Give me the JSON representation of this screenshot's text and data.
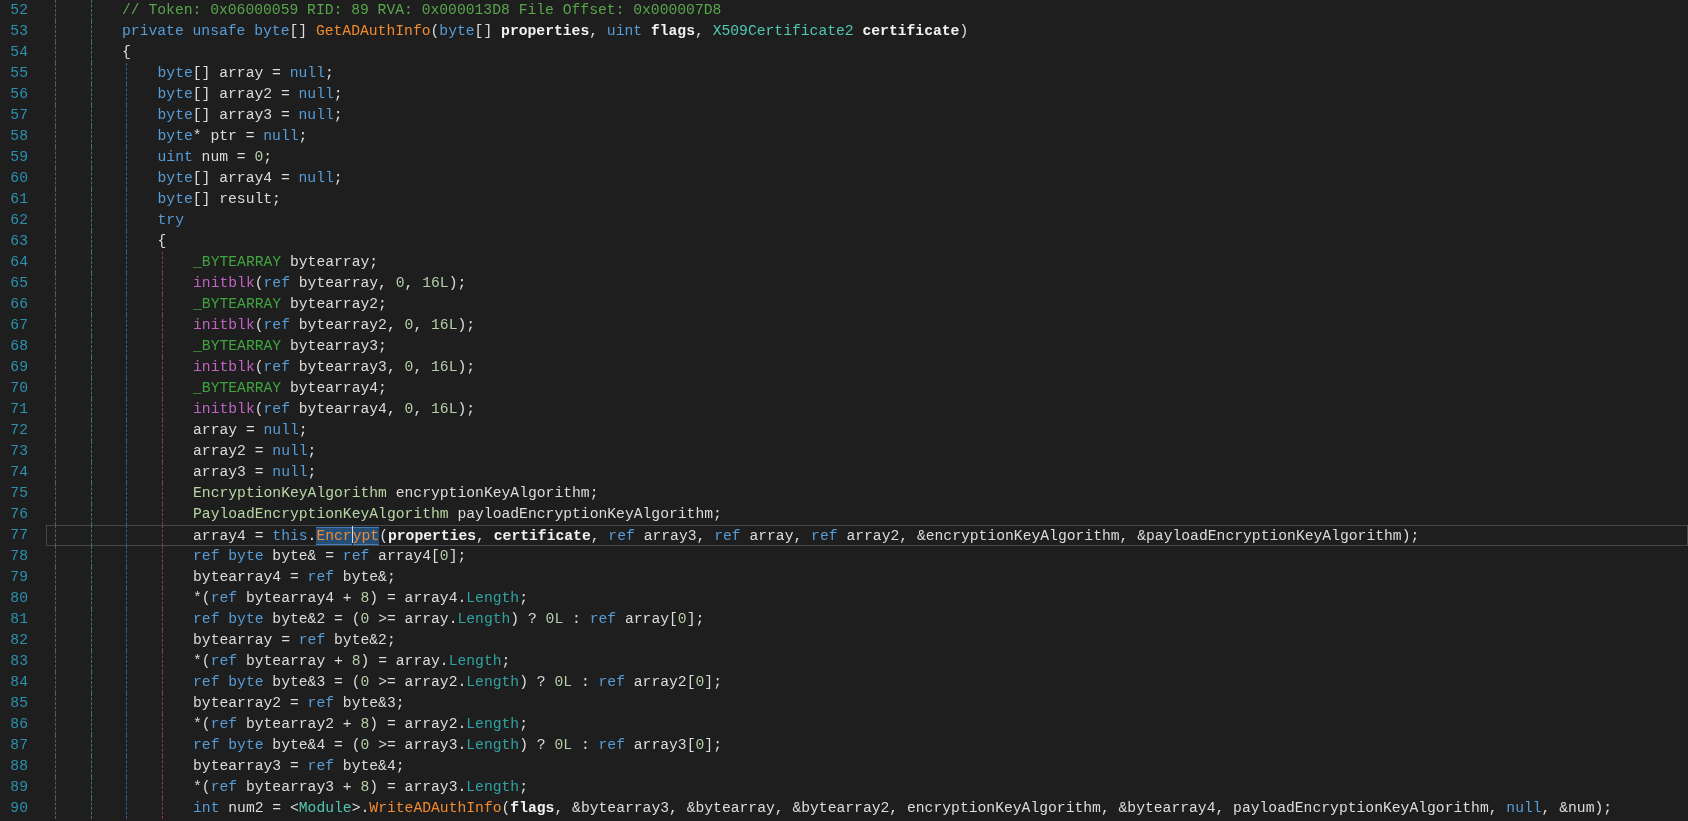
{
  "lines": [
    {
      "n": "52",
      "current": false,
      "tokens": [
        {
          "t": "// Token: 0x06000059 RID: 89 RVA: 0x000013D8 File Offset: 0x000007D8",
          "kind": "comment"
        }
      ]
    },
    {
      "n": "53",
      "current": false,
      "tokens": [
        {
          "t": "private unsafe byte",
          "kind": "keyword"
        },
        {
          "t": "[] ",
          "kind": "plain"
        },
        {
          "t": "GetADAuthInfo",
          "kind": "method"
        },
        {
          "t": "(",
          "kind": "plain"
        },
        {
          "t": "byte",
          "kind": "keyword"
        },
        {
          "t": "[] ",
          "kind": "plain"
        },
        {
          "t": "properties",
          "kind": "param"
        },
        {
          "t": ", ",
          "kind": "plain"
        },
        {
          "t": "uint ",
          "kind": "keyword"
        },
        {
          "t": "flags",
          "kind": "param"
        },
        {
          "t": ", ",
          "kind": "plain"
        },
        {
          "t": "X509Certificate2 ",
          "kind": "type"
        },
        {
          "t": "certificate",
          "kind": "param"
        },
        {
          "t": ")",
          "kind": "plain"
        }
      ]
    },
    {
      "n": "54",
      "current": false,
      "tokens": [
        {
          "t": "{",
          "kind": "plain"
        }
      ],
      "children": [
        {
          "n": "55",
          "current": false,
          "tokens": [
            {
              "t": "byte",
              "kind": "keyword"
            },
            {
              "t": "[] array = ",
              "kind": "plain"
            },
            {
              "t": "null",
              "kind": "keyword"
            },
            {
              "t": ";",
              "kind": "plain"
            }
          ]
        },
        {
          "n": "56",
          "current": false,
          "tokens": [
            {
              "t": "byte",
              "kind": "keyword"
            },
            {
              "t": "[] array2 = ",
              "kind": "plain"
            },
            {
              "t": "null",
              "kind": "keyword"
            },
            {
              "t": ";",
              "kind": "plain"
            }
          ]
        },
        {
          "n": "57",
          "current": false,
          "tokens": [
            {
              "t": "byte",
              "kind": "keyword"
            },
            {
              "t": "[] array3 = ",
              "kind": "plain"
            },
            {
              "t": "null",
              "kind": "keyword"
            },
            {
              "t": ";",
              "kind": "plain"
            }
          ]
        },
        {
          "n": "58",
          "current": false,
          "tokens": [
            {
              "t": "byte",
              "kind": "keyword"
            },
            {
              "t": "* ptr = ",
              "kind": "plain"
            },
            {
              "t": "null",
              "kind": "keyword"
            },
            {
              "t": ";",
              "kind": "plain"
            }
          ]
        },
        {
          "n": "59",
          "current": false,
          "tokens": [
            {
              "t": "uint",
              "kind": "keyword"
            },
            {
              "t": " num = ",
              "kind": "plain"
            },
            {
              "t": "0",
              "kind": "number"
            },
            {
              "t": ";",
              "kind": "plain"
            }
          ]
        },
        {
          "n": "60",
          "current": false,
          "tokens": [
            {
              "t": "byte",
              "kind": "keyword"
            },
            {
              "t": "[] array4 = ",
              "kind": "plain"
            },
            {
              "t": "null",
              "kind": "keyword"
            },
            {
              "t": ";",
              "kind": "plain"
            }
          ]
        },
        {
          "n": "61",
          "current": false,
          "tokens": [
            {
              "t": "byte",
              "kind": "keyword"
            },
            {
              "t": "[] result;",
              "kind": "plain"
            }
          ]
        },
        {
          "n": "62",
          "current": false,
          "tokens": [
            {
              "t": "try",
              "kind": "keyword"
            }
          ]
        },
        {
          "n": "63",
          "current": false,
          "tokens": [
            {
              "t": "{",
              "kind": "plain"
            }
          ],
          "children": [
            {
              "n": "64",
              "current": false,
              "tokens": [
                {
                  "t": "_BYTEARRAY",
                  "kind": "struct"
                },
                {
                  "t": " bytearray;",
                  "kind": "plain"
                }
              ]
            },
            {
              "n": "65",
              "current": false,
              "tokens": [
                {
                  "t": "initblk",
                  "kind": "intrinsic"
                },
                {
                  "t": "(",
                  "kind": "plain"
                },
                {
                  "t": "ref",
                  "kind": "keyword"
                },
                {
                  "t": " bytearray, ",
                  "kind": "plain"
                },
                {
                  "t": "0",
                  "kind": "number"
                },
                {
                  "t": ", ",
                  "kind": "plain"
                },
                {
                  "t": "16L",
                  "kind": "number"
                },
                {
                  "t": ");",
                  "kind": "plain"
                }
              ]
            },
            {
              "n": "66",
              "current": false,
              "tokens": [
                {
                  "t": "_BYTEARRAY",
                  "kind": "struct"
                },
                {
                  "t": " bytearray2;",
                  "kind": "plain"
                }
              ]
            },
            {
              "n": "67",
              "current": false,
              "tokens": [
                {
                  "t": "initblk",
                  "kind": "intrinsic"
                },
                {
                  "t": "(",
                  "kind": "plain"
                },
                {
                  "t": "ref",
                  "kind": "keyword"
                },
                {
                  "t": " bytearray2, ",
                  "kind": "plain"
                },
                {
                  "t": "0",
                  "kind": "number"
                },
                {
                  "t": ", ",
                  "kind": "plain"
                },
                {
                  "t": "16L",
                  "kind": "number"
                },
                {
                  "t": ");",
                  "kind": "plain"
                }
              ]
            },
            {
              "n": "68",
              "current": false,
              "tokens": [
                {
                  "t": "_BYTEARRAY",
                  "kind": "struct"
                },
                {
                  "t": " bytearray3;",
                  "kind": "plain"
                }
              ]
            },
            {
              "n": "69",
              "current": false,
              "tokens": [
                {
                  "t": "initblk",
                  "kind": "intrinsic"
                },
                {
                  "t": "(",
                  "kind": "plain"
                },
                {
                  "t": "ref",
                  "kind": "keyword"
                },
                {
                  "t": " bytearray3, ",
                  "kind": "plain"
                },
                {
                  "t": "0",
                  "kind": "number"
                },
                {
                  "t": ", ",
                  "kind": "plain"
                },
                {
                  "t": "16L",
                  "kind": "number"
                },
                {
                  "t": ");",
                  "kind": "plain"
                }
              ]
            },
            {
              "n": "70",
              "current": false,
              "tokens": [
                {
                  "t": "_BYTEARRAY",
                  "kind": "struct"
                },
                {
                  "t": " bytearray4;",
                  "kind": "plain"
                }
              ]
            },
            {
              "n": "71",
              "current": false,
              "tokens": [
                {
                  "t": "initblk",
                  "kind": "intrinsic"
                },
                {
                  "t": "(",
                  "kind": "plain"
                },
                {
                  "t": "ref",
                  "kind": "keyword"
                },
                {
                  "t": " bytearray4, ",
                  "kind": "plain"
                },
                {
                  "t": "0",
                  "kind": "number"
                },
                {
                  "t": ", ",
                  "kind": "plain"
                },
                {
                  "t": "16L",
                  "kind": "number"
                },
                {
                  "t": ");",
                  "kind": "plain"
                }
              ]
            },
            {
              "n": "72",
              "current": false,
              "tokens": [
                {
                  "t": "array = ",
                  "kind": "plain"
                },
                {
                  "t": "null",
                  "kind": "keyword"
                },
                {
                  "t": ";",
                  "kind": "plain"
                }
              ]
            },
            {
              "n": "73",
              "current": false,
              "tokens": [
                {
                  "t": "array2 = ",
                  "kind": "plain"
                },
                {
                  "t": "null",
                  "kind": "keyword"
                },
                {
                  "t": ";",
                  "kind": "plain"
                }
              ]
            },
            {
              "n": "74",
              "current": false,
              "tokens": [
                {
                  "t": "array3 = ",
                  "kind": "plain"
                },
                {
                  "t": "null",
                  "kind": "keyword"
                },
                {
                  "t": ";",
                  "kind": "plain"
                }
              ]
            },
            {
              "n": "75",
              "current": false,
              "tokens": [
                {
                  "t": "EncryptionKeyAlgorithm",
                  "kind": "enum"
                },
                {
                  "t": " encryptionKeyAlgorithm;",
                  "kind": "plain"
                }
              ]
            },
            {
              "n": "76",
              "current": false,
              "tokens": [
                {
                  "t": "PayloadEncryptionKeyAlgorithm",
                  "kind": "enum"
                },
                {
                  "t": " payloadEncryptionKeyAlgorithm;",
                  "kind": "plain"
                }
              ]
            },
            {
              "n": "77",
              "current": true,
              "tokens": [
                {
                  "t": "array4 = ",
                  "kind": "plain"
                },
                {
                  "t": "this",
                  "kind": "keyword"
                },
                {
                  "t": ".",
                  "kind": "plain"
                },
                {
                  "t": "Encr",
                  "kind": "method",
                  "selected": true,
                  "caret": true
                },
                {
                  "t": "ypt",
                  "kind": "method",
                  "selected": true
                },
                {
                  "t": "(",
                  "kind": "plain"
                },
                {
                  "t": "properties",
                  "kind": "param"
                },
                {
                  "t": ", ",
                  "kind": "plain"
                },
                {
                  "t": "certificate",
                  "kind": "param"
                },
                {
                  "t": ", ",
                  "kind": "plain"
                },
                {
                  "t": "ref",
                  "kind": "keyword"
                },
                {
                  "t": " array3, ",
                  "kind": "plain"
                },
                {
                  "t": "ref",
                  "kind": "keyword"
                },
                {
                  "t": " array, ",
                  "kind": "plain"
                },
                {
                  "t": "ref",
                  "kind": "keyword"
                },
                {
                  "t": " array2, &encryptionKeyAlgorithm, &payloadEncryptionKeyAlgorithm);",
                  "kind": "plain"
                }
              ]
            },
            {
              "n": "78",
              "current": false,
              "tokens": [
                {
                  "t": "ref byte",
                  "kind": "keyword"
                },
                {
                  "t": " byte& = ",
                  "kind": "plain"
                },
                {
                  "t": "ref",
                  "kind": "keyword"
                },
                {
                  "t": " array4[",
                  "kind": "plain"
                },
                {
                  "t": "0",
                  "kind": "number"
                },
                {
                  "t": "];",
                  "kind": "plain"
                }
              ]
            },
            {
              "n": "79",
              "current": false,
              "tokens": [
                {
                  "t": "bytearray4 = ",
                  "kind": "plain"
                },
                {
                  "t": "ref",
                  "kind": "keyword"
                },
                {
                  "t": " byte&;",
                  "kind": "plain"
                }
              ]
            },
            {
              "n": "80",
              "current": false,
              "tokens": [
                {
                  "t": "*(",
                  "kind": "plain"
                },
                {
                  "t": "ref",
                  "kind": "keyword"
                },
                {
                  "t": " bytearray4 + ",
                  "kind": "plain"
                },
                {
                  "t": "8",
                  "kind": "number"
                },
                {
                  "t": ") = array4.",
                  "kind": "plain"
                },
                {
                  "t": "Length",
                  "kind": "property"
                },
                {
                  "t": ";",
                  "kind": "plain"
                }
              ]
            },
            {
              "n": "81",
              "current": false,
              "tokens": [
                {
                  "t": "ref byte",
                  "kind": "keyword"
                },
                {
                  "t": " byte&2 = (",
                  "kind": "plain"
                },
                {
                  "t": "0",
                  "kind": "number"
                },
                {
                  "t": " >= array.",
                  "kind": "plain"
                },
                {
                  "t": "Length",
                  "kind": "property"
                },
                {
                  "t": ") ? ",
                  "kind": "plain"
                },
                {
                  "t": "0L",
                  "kind": "number"
                },
                {
                  "t": " : ",
                  "kind": "plain"
                },
                {
                  "t": "ref",
                  "kind": "keyword"
                },
                {
                  "t": " array[",
                  "kind": "plain"
                },
                {
                  "t": "0",
                  "kind": "number"
                },
                {
                  "t": "];",
                  "kind": "plain"
                }
              ]
            },
            {
              "n": "82",
              "current": false,
              "tokens": [
                {
                  "t": "bytearray = ",
                  "kind": "plain"
                },
                {
                  "t": "ref",
                  "kind": "keyword"
                },
                {
                  "t": " byte&2;",
                  "kind": "plain"
                }
              ]
            },
            {
              "n": "83",
              "current": false,
              "tokens": [
                {
                  "t": "*(",
                  "kind": "plain"
                },
                {
                  "t": "ref",
                  "kind": "keyword"
                },
                {
                  "t": " bytearray + ",
                  "kind": "plain"
                },
                {
                  "t": "8",
                  "kind": "number"
                },
                {
                  "t": ") = array.",
                  "kind": "plain"
                },
                {
                  "t": "Length",
                  "kind": "property"
                },
                {
                  "t": ";",
                  "kind": "plain"
                }
              ]
            },
            {
              "n": "84",
              "current": false,
              "tokens": [
                {
                  "t": "ref byte",
                  "kind": "keyword"
                },
                {
                  "t": " byte&3 = (",
                  "kind": "plain"
                },
                {
                  "t": "0",
                  "kind": "number"
                },
                {
                  "t": " >= array2.",
                  "kind": "plain"
                },
                {
                  "t": "Length",
                  "kind": "property"
                },
                {
                  "t": ") ? ",
                  "kind": "plain"
                },
                {
                  "t": "0L",
                  "kind": "number"
                },
                {
                  "t": " : ",
                  "kind": "plain"
                },
                {
                  "t": "ref",
                  "kind": "keyword"
                },
                {
                  "t": " array2[",
                  "kind": "plain"
                },
                {
                  "t": "0",
                  "kind": "number"
                },
                {
                  "t": "];",
                  "kind": "plain"
                }
              ]
            },
            {
              "n": "85",
              "current": false,
              "tokens": [
                {
                  "t": "bytearray2 = ",
                  "kind": "plain"
                },
                {
                  "t": "ref",
                  "kind": "keyword"
                },
                {
                  "t": " byte&3;",
                  "kind": "plain"
                }
              ]
            },
            {
              "n": "86",
              "current": false,
              "tokens": [
                {
                  "t": "*(",
                  "kind": "plain"
                },
                {
                  "t": "ref",
                  "kind": "keyword"
                },
                {
                  "t": " bytearray2 + ",
                  "kind": "plain"
                },
                {
                  "t": "8",
                  "kind": "number"
                },
                {
                  "t": ") = array2.",
                  "kind": "plain"
                },
                {
                  "t": "Length",
                  "kind": "property"
                },
                {
                  "t": ";",
                  "kind": "plain"
                }
              ]
            },
            {
              "n": "87",
              "current": false,
              "tokens": [
                {
                  "t": "ref byte",
                  "kind": "keyword"
                },
                {
                  "t": " byte&4 = (",
                  "kind": "plain"
                },
                {
                  "t": "0",
                  "kind": "number"
                },
                {
                  "t": " >= array3.",
                  "kind": "plain"
                },
                {
                  "t": "Length",
                  "kind": "property"
                },
                {
                  "t": ") ? ",
                  "kind": "plain"
                },
                {
                  "t": "0L",
                  "kind": "number"
                },
                {
                  "t": " : ",
                  "kind": "plain"
                },
                {
                  "t": "ref",
                  "kind": "keyword"
                },
                {
                  "t": " array3[",
                  "kind": "plain"
                },
                {
                  "t": "0",
                  "kind": "number"
                },
                {
                  "t": "];",
                  "kind": "plain"
                }
              ]
            },
            {
              "n": "88",
              "current": false,
              "tokens": [
                {
                  "t": "bytearray3 = ",
                  "kind": "plain"
                },
                {
                  "t": "ref",
                  "kind": "keyword"
                },
                {
                  "t": " byte&4;",
                  "kind": "plain"
                }
              ]
            },
            {
              "n": "89",
              "current": false,
              "tokens": [
                {
                  "t": "*(",
                  "kind": "plain"
                },
                {
                  "t": "ref",
                  "kind": "keyword"
                },
                {
                  "t": " bytearray3 + ",
                  "kind": "plain"
                },
                {
                  "t": "8",
                  "kind": "number"
                },
                {
                  "t": ") = array3.",
                  "kind": "plain"
                },
                {
                  "t": "Length",
                  "kind": "property"
                },
                {
                  "t": ";",
                  "kind": "plain"
                }
              ]
            },
            {
              "n": "90",
              "current": false,
              "tokens": [
                {
                  "t": "int",
                  "kind": "keyword"
                },
                {
                  "t": " num2 = <",
                  "kind": "plain"
                },
                {
                  "t": "Module",
                  "kind": "type"
                },
                {
                  "t": ">.",
                  "kind": "plain"
                },
                {
                  "t": "WriteADAuthInfo",
                  "kind": "method"
                },
                {
                  "t": "(",
                  "kind": "plain"
                },
                {
                  "t": "flags",
                  "kind": "param"
                },
                {
                  "t": ", &bytearray3, &bytearray, &bytearray2, encryptionKeyAlgorithm, &bytearray4, payloadEncryptionKeyAlgorithm, ",
                  "kind": "plain"
                },
                {
                  "t": "null",
                  "kind": "keyword"
                },
                {
                  "t": ", &num);",
                  "kind": "plain"
                }
              ]
            }
          ]
        }
      ]
    }
  ]
}
